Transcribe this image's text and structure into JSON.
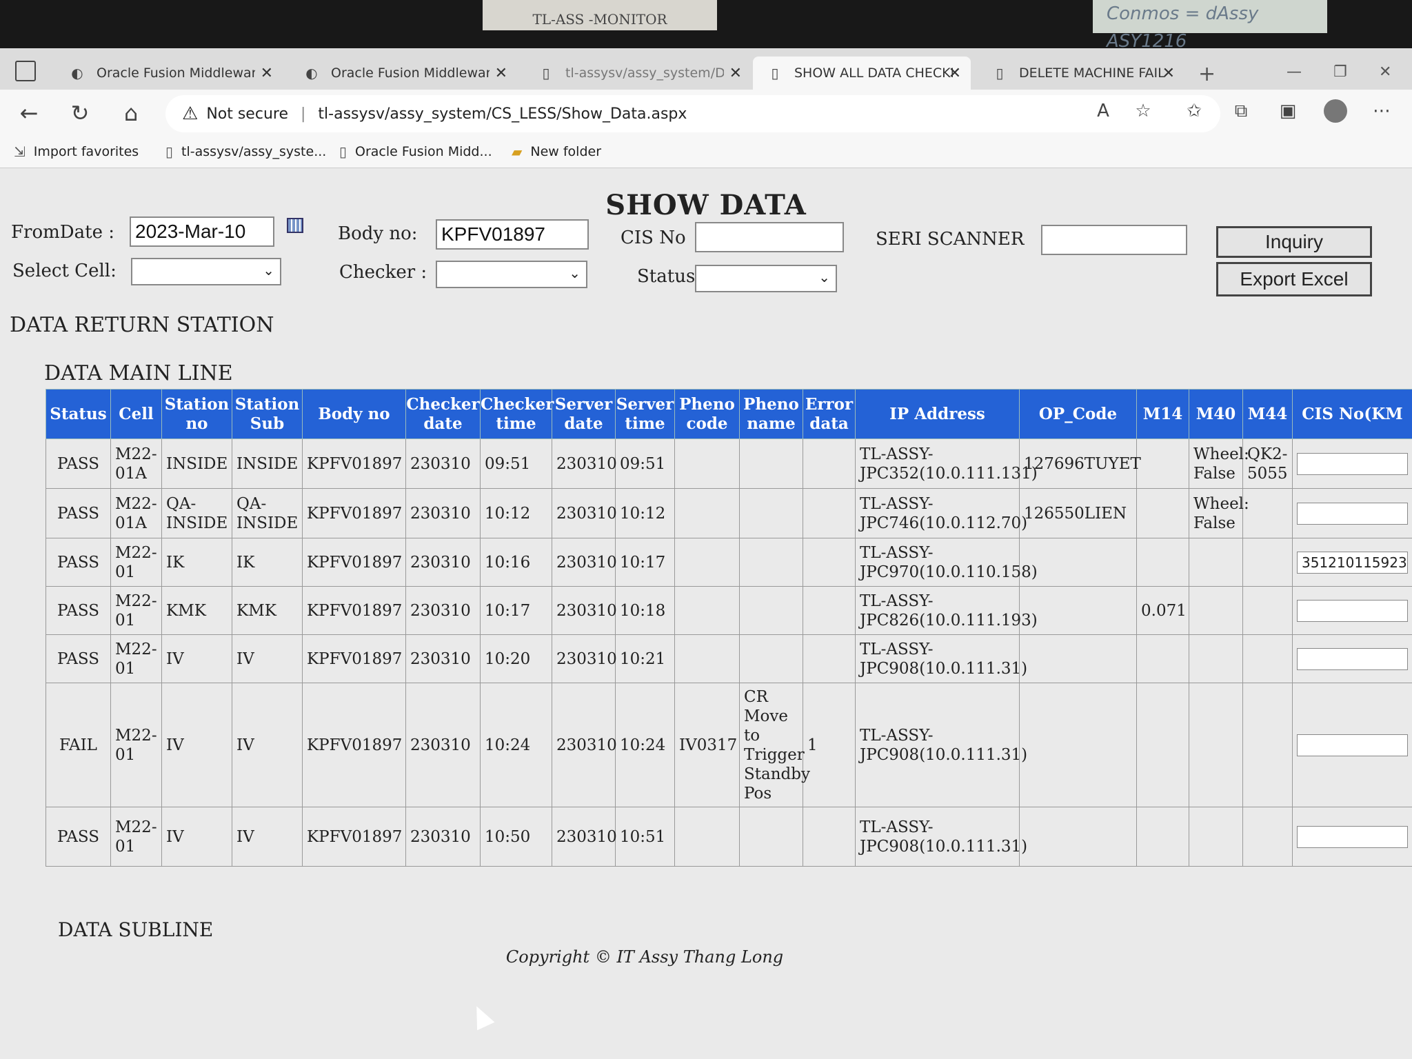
{
  "monitor": {
    "sticker_label": "TL-ASS -MONITOR",
    "note": "Conmos = dAssy ASY1216"
  },
  "browser": {
    "tabs": [
      {
        "label": "Oracle Fusion Middleware",
        "icon": "oracle-icon"
      },
      {
        "label": "Oracle Fusion Middleware",
        "icon": "oracle-icon"
      },
      {
        "label": "tl-assysv/assy_system/Defa",
        "icon": "page-icon"
      },
      {
        "label": "SHOW ALL DATA CHECKER",
        "icon": "page-icon"
      },
      {
        "label": "DELETE MACHINE FAIL",
        "icon": "page-icon"
      }
    ],
    "security_label": "Not secure",
    "url": "tl-assysv/assy_system/CS_LESS/Show_Data.aspx",
    "favorites": [
      "Import favorites",
      "tl-assysv/assy_syste...",
      "Oracle Fusion Midd...",
      "New folder"
    ]
  },
  "page": {
    "title": "SHOW DATA",
    "filters": {
      "from_date_label": "FromDate :",
      "from_date_value": "2023-Mar-10",
      "body_no_label": "Body no:",
      "body_no_value": "KPFV01897",
      "cis_no_label": "CIS No",
      "seri_scanner_label": "SERI SCANNER",
      "select_cell_label": "Select Cell:",
      "checker_label": "Checker :",
      "status_label": "Status:"
    },
    "buttons": {
      "inquiry": "Inquiry",
      "export": "Export Excel"
    },
    "sections": {
      "return_station": "DATA RETURN STATION",
      "main_line": "DATA MAIN LINE",
      "subline": "DATA SUBLINE"
    },
    "copyright": "Copyright © IT Assy Thang Long"
  },
  "table": {
    "columns": [
      "Status",
      "Cell",
      "Station no",
      "Station Sub",
      "Body no",
      "Checker date",
      "Checker time",
      "Server date",
      "Server time",
      "Pheno code",
      "Pheno name",
      "Error data",
      "IP Address",
      "OP_Code",
      "M14",
      "M40",
      "M44",
      "CIS No(KM"
    ],
    "rows": [
      [
        "PASS",
        "M22-01A",
        "INSIDE",
        "INSIDE",
        "KPFV01897",
        "230310",
        "09:51",
        "230310",
        "09:51",
        "",
        "",
        "",
        "TL-ASSY-JPC352(10.0.111.131)",
        "127696TUYET",
        "",
        "Wheel: False",
        "QK2-5055",
        ""
      ],
      [
        "PASS",
        "M22-01A",
        "QA-INSIDE",
        "QA-INSIDE",
        "KPFV01897",
        "230310",
        "10:12",
        "230310",
        "10:12",
        "",
        "",
        "",
        "TL-ASSY-JPC746(10.0.112.70)",
        "126550LIEN",
        "",
        "Wheel: False",
        "",
        ""
      ],
      [
        "PASS",
        "M22-01",
        "IK",
        "IK",
        "KPFV01897",
        "230310",
        "10:16",
        "230310",
        "10:17",
        "",
        "",
        "",
        "TL-ASSY-JPC970(10.0.110.158)",
        "",
        "",
        "",
        "",
        "351210115923"
      ],
      [
        "PASS",
        "M22-01",
        "KMK",
        "KMK",
        "KPFV01897",
        "230310",
        "10:17",
        "230310",
        "10:18",
        "",
        "",
        "",
        "TL-ASSY-JPC826(10.0.111.193)",
        "",
        "0.071",
        "",
        "",
        ""
      ],
      [
        "PASS",
        "M22-01",
        "IV",
        "IV",
        "KPFV01897",
        "230310",
        "10:20",
        "230310",
        "10:21",
        "",
        "",
        "",
        "TL-ASSY-JPC908(10.0.111.31)",
        "",
        "",
        "",
        "",
        ""
      ],
      [
        "FAIL",
        "M22-01",
        "IV",
        "IV",
        "KPFV01897",
        "230310",
        "10:24",
        "230310",
        "10:24",
        "IV0317",
        "CR Move to Trigger Standby Pos",
        "1",
        "TL-ASSY-JPC908(10.0.111.31)",
        "",
        "",
        "",
        "",
        ""
      ],
      [
        "PASS",
        "M22-01",
        "IV",
        "IV",
        "KPFV01897",
        "230310",
        "10:50",
        "230310",
        "10:51",
        "",
        "",
        "",
        "TL-ASSY-JPC908(10.0.111.31)",
        "",
        "",
        "",
        "",
        ""
      ]
    ]
  }
}
